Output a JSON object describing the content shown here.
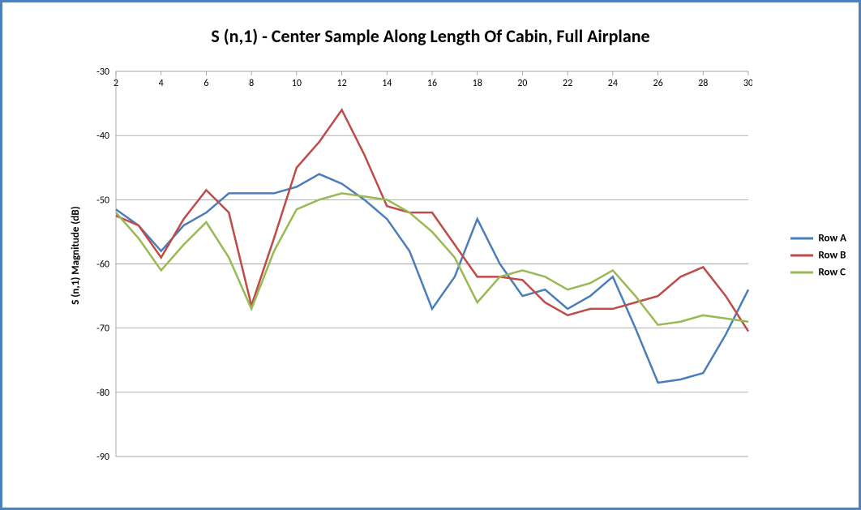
{
  "chart_data": {
    "type": "line",
    "title": "S (n,1) - Center Sample Along Length Of Cabin, Full Airplane",
    "xlabel": "",
    "ylabel": "S (n,1) Magnitude (dB)",
    "x": [
      2,
      3,
      4,
      5,
      6,
      7,
      8,
      9,
      10,
      11,
      12,
      13,
      14,
      15,
      16,
      17,
      18,
      19,
      20,
      21,
      22,
      23,
      24,
      25,
      26,
      27,
      28,
      29,
      30
    ],
    "xticks": [
      2,
      4,
      6,
      8,
      10,
      12,
      14,
      16,
      18,
      20,
      22,
      24,
      26,
      28,
      30
    ],
    "yticks": [
      -30,
      -40,
      -50,
      -60,
      -70,
      -80,
      -90
    ],
    "ylim": [
      -90,
      -30
    ],
    "series": [
      {
        "name": "Row A",
        "color": "#4a7ebb",
        "values": [
          -51.5,
          -54,
          -58,
          -54,
          -52,
          -49,
          -49,
          -49,
          -48,
          -46,
          -47.5,
          -50,
          -53,
          -58,
          -67,
          -62,
          -53,
          -60,
          -65,
          -64,
          -67,
          -65,
          -62,
          -70,
          -78.5,
          -78,
          -77,
          -71,
          -64
        ]
      },
      {
        "name": "Row B",
        "color": "#be4b48",
        "values": [
          -52.5,
          -54,
          -59,
          -53,
          -48.5,
          -52,
          -66.5,
          -56,
          -45,
          -41,
          -36,
          -43,
          -51,
          -52,
          -52,
          -57,
          -62,
          -62,
          -62.5,
          -66,
          -68,
          -67,
          -67,
          -66,
          -65,
          -62,
          -60.5,
          -65,
          -70.5
        ]
      },
      {
        "name": "Row C",
        "color": "#98b954",
        "values": [
          -52,
          -56,
          -61,
          -57,
          -53.5,
          -59,
          -67,
          -58,
          -51.5,
          -50,
          -49,
          -49.5,
          -50,
          -52,
          -55,
          -59,
          -66,
          -62,
          -61,
          -62,
          -64,
          -63,
          -61,
          -65,
          -69.5,
          -69,
          -68,
          -68.5,
          -69
        ]
      }
    ],
    "legend_position": "right",
    "grid": true
  }
}
